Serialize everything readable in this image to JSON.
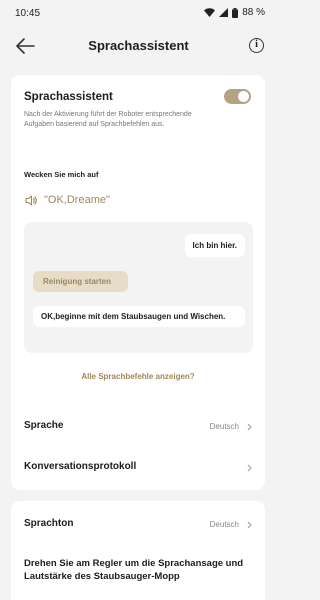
{
  "status_bar": {
    "time": "10:45",
    "battery": "88 %"
  },
  "header": {
    "title": "Sprachassistent",
    "info_label": "i"
  },
  "voice_assistant": {
    "title": "Sprachassistent",
    "toggle_on": true,
    "description": "Nach der Aktivierung führt der Roboter entsprechende Aufgaben basierend auf Sprachbefehlen aus."
  },
  "wake": {
    "label": "Wecken Sie mich auf",
    "icon": "speaker-icon",
    "phrase": "\"OK,Dreame\""
  },
  "chat": {
    "reply_1": "Ich bin hier.",
    "command": "Reinigung starten",
    "reply_2": "OK,beginne mit dem Staubsaugen und Wischen."
  },
  "all_commands_link": "Alle Sprachbefehle anzeigen?",
  "settings": {
    "language_label": "Sprache",
    "language_value": "Deutsch",
    "protocol_label": "Konversationsprotokoll",
    "tone_label": "Sprachton",
    "tone_value": "Deutsch",
    "dial_text": "Drehen Sie am Regler um die Sprachansage und Lautstärke des Staubsauger-Mopp"
  },
  "colors": {
    "accent": "#a0875a",
    "toggle": "#b5a283",
    "bubble_accent": "#e7dcc5"
  }
}
